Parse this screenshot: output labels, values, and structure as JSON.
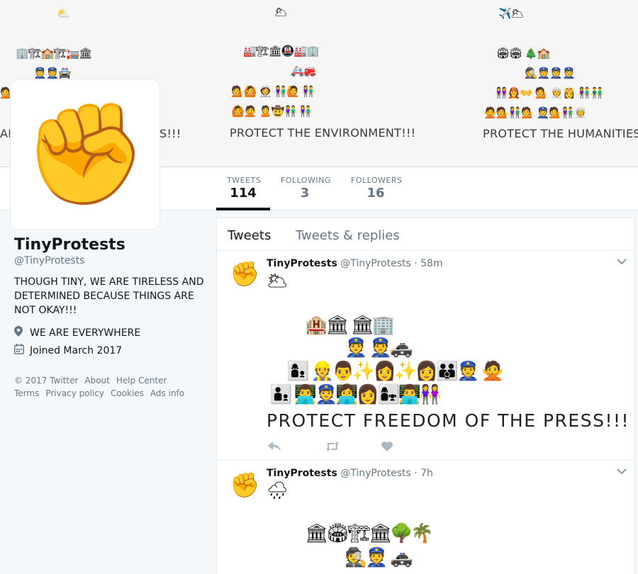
{
  "banner": {
    "emoji_lines": [
      "⛅",
      "🌥",
      "✈️🌥",
      "🏢🏗🏫🏗🏣🏛",
      "🏭🏗🏛🚇🏭🏢",
      "🏟🏟      🎄🏫",
      "👮👮🚔",
      "🚑🚒",
      "🕵👮👮👮",
      "👫",
      "💁🙆          👩‍🚀          👫🙋          👫",
      "👭👩‍🚒👐   💁        👳👸        👫👬",
      "💁",
      "🙆🙅  🙎🤠👫          👫",
      "🙅💁👫💁          👮💁👫👳"
    ],
    "texts": [
      "AR",
      "S!!!",
      "PROTECT THE ENVIRONMENT!!!",
      "PROTECT THE HUMANITIES"
    ]
  },
  "avatar": {
    "emoji": "✊"
  },
  "nav": {
    "stats": [
      {
        "label": "TWEETS",
        "value": "114"
      },
      {
        "label": "FOLLOWING",
        "value": "3"
      },
      {
        "label": "FOLLOWERS",
        "value": "16"
      }
    ]
  },
  "profile": {
    "name": "TinyProtests",
    "handle": "@TinyProtests",
    "bio": "THOUGH TINY, WE ARE TIRELESS AND DETERMINED BECAUSE THINGS ARE NOT OKAY!!!",
    "location": "WE ARE EVERYWHERE",
    "joined": "Joined March 2017",
    "location_icon": "map-pin-icon",
    "calendar_icon": "calendar-icon"
  },
  "footer": {
    "row1": [
      "© 2017 Twitter",
      "About",
      "Help Center"
    ],
    "row2": [
      "Terms",
      "Privacy policy",
      "Cookies",
      "Ads info"
    ]
  },
  "tabs": [
    "Tweets",
    "Tweets & replies"
  ],
  "tweets": [
    {
      "name": "TinyProtests",
      "handle": "@TinyProtests",
      "time": "· 58m",
      "avatar": "✊",
      "sky": "🌥",
      "rows": [
        "🏨🏛  🏛🏢",
        "👮        👮🚓",
        "👩‍👦    👷👨✨👩✨👩👪👮        🙅",
        "👨‍👦    👨‍💻👮👩‍💻👩👩‍👧👨‍💻👭"
      ],
      "text": "PROTECT FREEDOM OF THE PRESS!!!"
    },
    {
      "name": "TinyProtests",
      "handle": "@TinyProtests",
      "time": "· 7h",
      "avatar": "✊",
      "sky": "🌧",
      "rows": [
        "🏛🏟🏗🏛🌳🌴",
        "🕵👮        🚓"
      ]
    }
  ],
  "action_icons": [
    "reply-icon",
    "retweet-icon",
    "like-icon"
  ]
}
